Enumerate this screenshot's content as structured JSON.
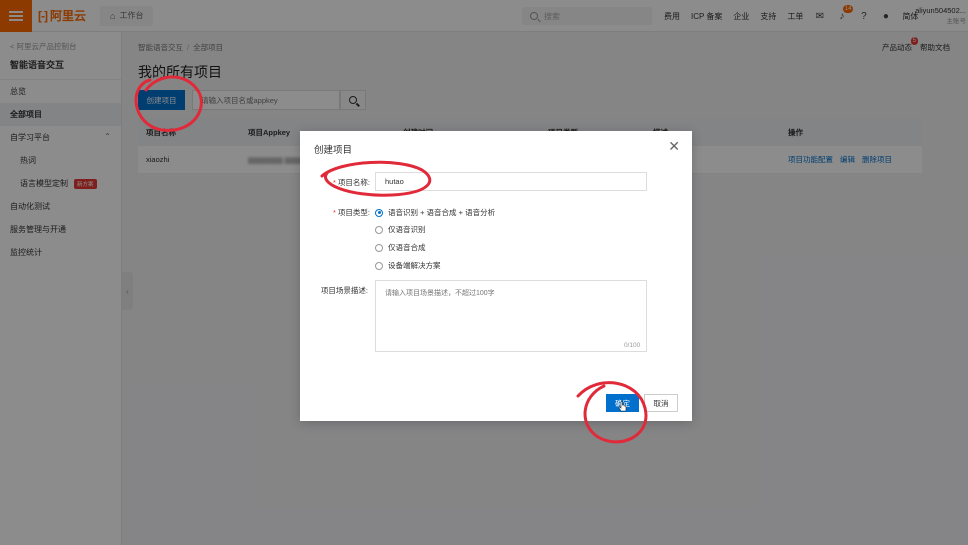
{
  "topbar": {
    "logo_text": "阿里云",
    "workbench": "工作台",
    "search_placeholder": "搜索",
    "links": [
      "费用",
      "ICP 备案",
      "企业",
      "支持",
      "工单"
    ],
    "notification_count": "14",
    "lang": "简体",
    "user_name": "aliyun504502...",
    "user_sub": "主账号"
  },
  "sidebar": {
    "back": "< 阿里云产品控制台",
    "title": "智能语音交互",
    "items": [
      {
        "label": "总览"
      },
      {
        "label": "全部项目"
      },
      {
        "label": "自学习平台"
      },
      {
        "label": "热词"
      },
      {
        "label": "语言模型定制"
      },
      {
        "label": "自动化测试"
      },
      {
        "label": "服务管理与开通"
      },
      {
        "label": "监控统计"
      }
    ],
    "badge": "新方案"
  },
  "main": {
    "breadcrumb": [
      "智能语音交互",
      "全部项目"
    ],
    "right_links": [
      "产品动态",
      "帮助文档"
    ],
    "notif_count": "5",
    "title": "我的所有项目",
    "create_button": "创建项目",
    "search_placeholder": "请输入项目名或appkey",
    "table": {
      "headers": [
        "项目名称",
        "项目Appkey",
        "创建时间",
        "项目类型",
        "描述",
        "操作"
      ],
      "row": {
        "name": "xiaozhi",
        "ops": [
          "项目功能配置",
          "编辑",
          "删除项目"
        ]
      }
    }
  },
  "dialog": {
    "title": "创建项目",
    "name_label": "项目名称:",
    "name_value": "hutao",
    "type_label": "项目类型:",
    "options": [
      "语音识别 + 语音合成 + 语音分析",
      "仅语音识别",
      "仅语音合成",
      "设备端解决方案"
    ],
    "selected_index": 0,
    "desc_label": "项目场景描述:",
    "desc_placeholder": "请输入项目场景描述，不超过100字",
    "counter": "0/100",
    "ok": "确定",
    "cancel": "取消"
  }
}
